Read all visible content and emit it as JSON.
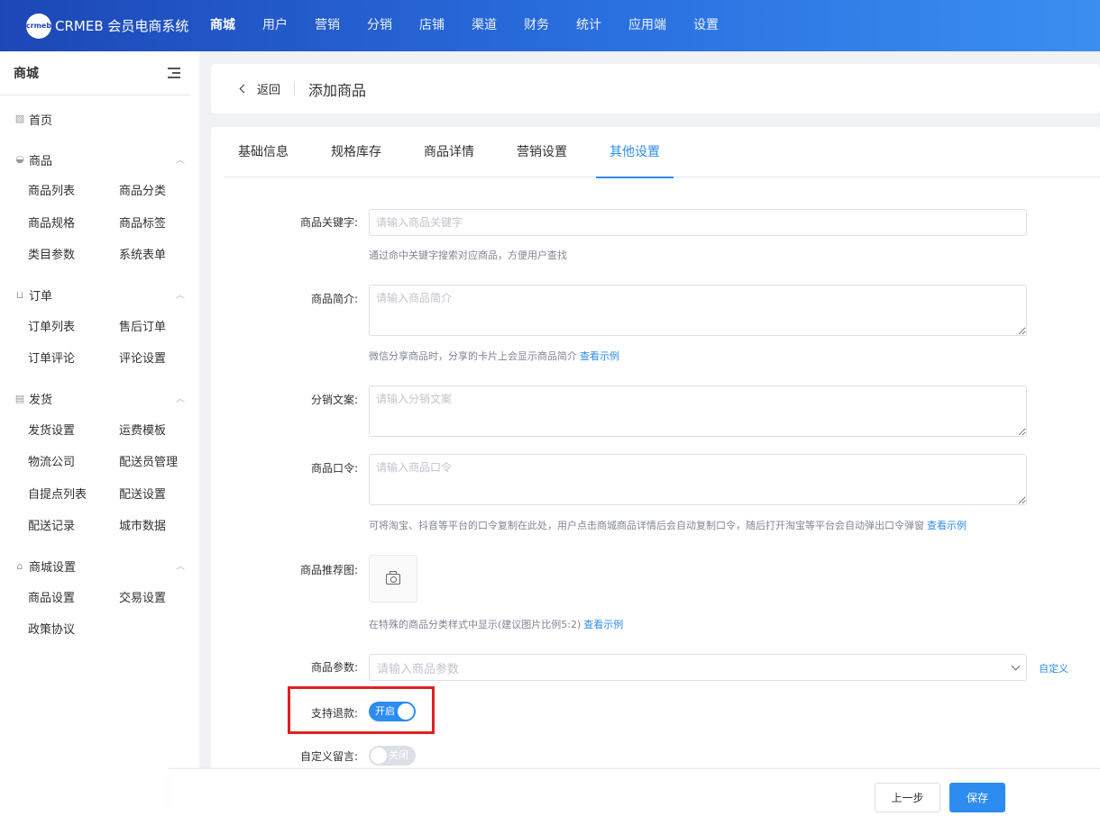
{
  "topbar": {
    "logo_text": "crmeb",
    "brand": "CRMEB 会员电商系统",
    "nav": [
      "商城",
      "用户",
      "营销",
      "分销",
      "店铺",
      "渠道",
      "财务",
      "统计",
      "应用端",
      "设置"
    ],
    "active_nav": "商城"
  },
  "sidebar": {
    "title": "商城",
    "home": "首页",
    "groups": [
      {
        "label": "商品",
        "icon": "basket-icon",
        "items": [
          "商品列表",
          "商品分类",
          "商品规格",
          "商品标签",
          "类目参数",
          "系统表单"
        ]
      },
      {
        "label": "订单",
        "icon": "cart-icon",
        "items": [
          "订单列表",
          "售后订单",
          "订单评论",
          "评论设置"
        ]
      },
      {
        "label": "发货",
        "icon": "box-icon",
        "items": [
          "发货设置",
          "运费模板",
          "物流公司",
          "配送员管理",
          "自提点列表",
          "配送设置",
          "配送记录",
          "城市数据"
        ]
      },
      {
        "label": "商城设置",
        "icon": "store-icon",
        "items": [
          "商品设置",
          "交易设置",
          "政策协议"
        ]
      }
    ]
  },
  "crumb": {
    "back": "返回",
    "title": "添加商品"
  },
  "tabs": [
    "基础信息",
    "规格库存",
    "商品详情",
    "营销设置",
    "其他设置"
  ],
  "active_tab": "其他设置",
  "form": {
    "keyword": {
      "label": "商品关键字:",
      "placeholder": "请输入商品关键字",
      "help": "通过命中关键字搜索对应商品，方便用户查找"
    },
    "intro": {
      "label": "商品简介:",
      "placeholder": "请输入商品简介",
      "help": "微信分享商品时，分享的卡片上会显示商品简介",
      "link": "查看示例"
    },
    "dist_copy": {
      "label": "分销文案:",
      "placeholder": "请输入分销文案"
    },
    "command": {
      "label": "商品口令:",
      "placeholder": "请输入商品口令",
      "help": "可将淘宝、抖音等平台的口令复制在此处，用户点击商城商品详情后会自动复制口令，随后打开淘宝等平台会自动弹出口令弹窗",
      "link": "查看示例"
    },
    "recommend_img": {
      "label": "商品推荐图:",
      "help": "在特殊的商品分类样式中显示(建议图片比例5:2)",
      "link": "查看示例"
    },
    "params": {
      "label": "商品参数:",
      "placeholder": "请输入商品参数",
      "custom": "自定义"
    },
    "refund": {
      "label": "支持退款:",
      "state": "开启"
    },
    "custom_msg": {
      "label": "自定义留言:",
      "state": "关闭"
    }
  },
  "footer": {
    "prev": "上一步",
    "save": "保存"
  }
}
